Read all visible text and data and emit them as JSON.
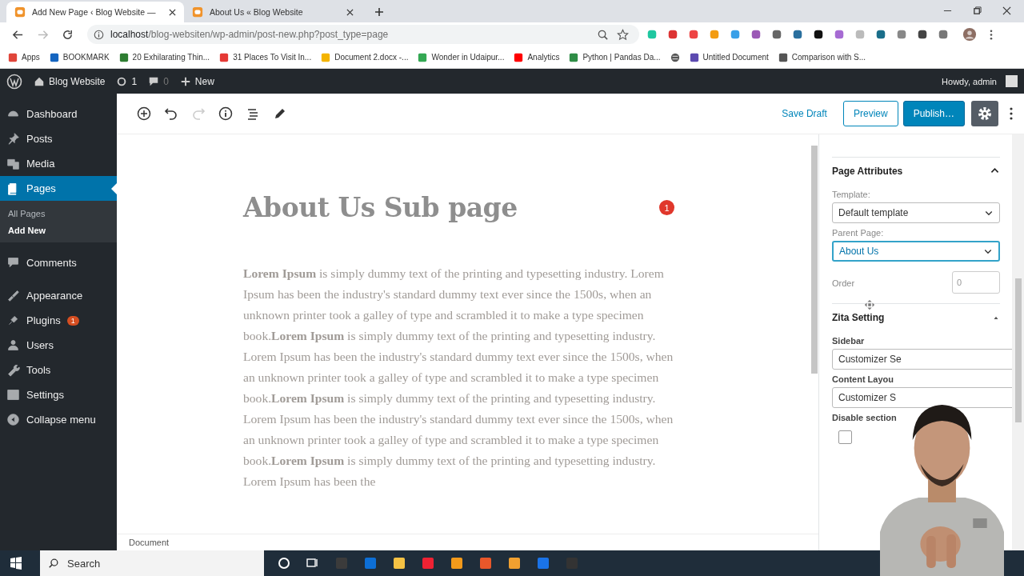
{
  "browser": {
    "tabs": [
      {
        "title": "Add New Page ‹ Blog Website —",
        "selected": true
      },
      {
        "title": "About Us « Blog Website",
        "selected": false
      }
    ],
    "url_host": "localhost",
    "url_path": "/blog-websiten/wp-admin/post-new.php?post_type=page",
    "bookmarks": [
      {
        "kind": "link",
        "label": "Apps",
        "color": "#e0453a"
      },
      {
        "kind": "link",
        "label": "BOOKMARK",
        "color": "#1565c0"
      },
      {
        "kind": "link",
        "label": "20 Exhilarating Thin...",
        "color": "#2e7d32"
      },
      {
        "kind": "link",
        "label": "31 Places To Visit In...",
        "color": "#e53935"
      },
      {
        "kind": "link",
        "label": "Document 2.docx -...",
        "color": "#f4b400"
      },
      {
        "kind": "link",
        "label": "Wonder in Udaipur...",
        "color": "#34a853"
      },
      {
        "kind": "link",
        "label": "Analytics",
        "color": "#ff0000"
      },
      {
        "kind": "link",
        "label": "Python | Pandas Da...",
        "color": "#2f8d46"
      },
      {
        "kind": "icon",
        "color": "#555555"
      },
      {
        "kind": "link",
        "label": "Untitled Document",
        "color": "#5c4ab0"
      },
      {
        "kind": "link",
        "label": "Comparison with S...",
        "color": "#555555"
      }
    ]
  },
  "admin_bar": {
    "site": "Blog Website",
    "updates": "1",
    "comments": "0",
    "new": "New",
    "greeting": "Howdy, admin"
  },
  "sidebar": {
    "items": [
      {
        "label": "Dashboard",
        "selected": false
      },
      {
        "label": "Posts",
        "selected": false
      },
      {
        "label": "Media",
        "selected": false
      },
      {
        "label": "Pages",
        "selected": true,
        "children": [
          {
            "label": "All Pages",
            "selected": false
          },
          {
            "label": "Add New",
            "selected": true
          }
        ]
      },
      {
        "label": "Comments",
        "selected": false
      },
      {
        "label": "Appearance",
        "selected": false
      },
      {
        "label": "Plugins",
        "selected": false,
        "badge": "1"
      },
      {
        "label": "Users",
        "selected": false
      },
      {
        "label": "Tools",
        "selected": false
      },
      {
        "label": "Settings",
        "selected": false
      },
      {
        "label": "Collapse menu",
        "selected": false
      }
    ]
  },
  "toolbar": {
    "save_draft": "Save Draft",
    "preview": "Preview",
    "publish": "Publish…"
  },
  "editor": {
    "title": "About Us Sub page",
    "notice_badge": "1",
    "paragraph": "**Lorem Ipsum** is simply dummy text of the printing and typesetting industry. Lorem Ipsum has been the industry's standard dummy text ever since the 1500s, when an unknown printer took a galley of type and scrambled it to make a type specimen book.**Lorem Ipsum** is simply dummy text of the printing and typesetting industry. Lorem Ipsum has been the industry's standard dummy text ever since the 1500s, when an unknown printer took a galley of type and scrambled it to make a type specimen book.**Lorem Ipsum** is simply dummy text of the printing and typesetting industry. Lorem Ipsum has been the industry's standard dummy text ever since the 1500s, when an unknown printer took a galley of type and scrambled it to make a type specimen book.**Lorem Ipsum** is simply dummy text of the printing and typesetting industry. Lorem Ipsum has been the"
  },
  "status_bar": "Document",
  "settings_panel": {
    "page_attributes": {
      "title": "Page Attributes",
      "expanded": true,
      "template_label": "Template:",
      "template_value": "Default template",
      "parent_label": "Parent Page:",
      "parent_value": "About Us",
      "parent_focused": true,
      "order_label": "Order",
      "order_value": "0"
    },
    "zita": {
      "title": "Zita Setting",
      "expanded": true,
      "sidebar_label": "Sidebar",
      "sidebar_value": "Customizer Se",
      "layout_label": "Content Layou",
      "layout_value": "Customizer S",
      "disable_label": "Disable section",
      "disable_checked": false
    }
  },
  "taskbar": {
    "search_placeholder": "Search"
  }
}
